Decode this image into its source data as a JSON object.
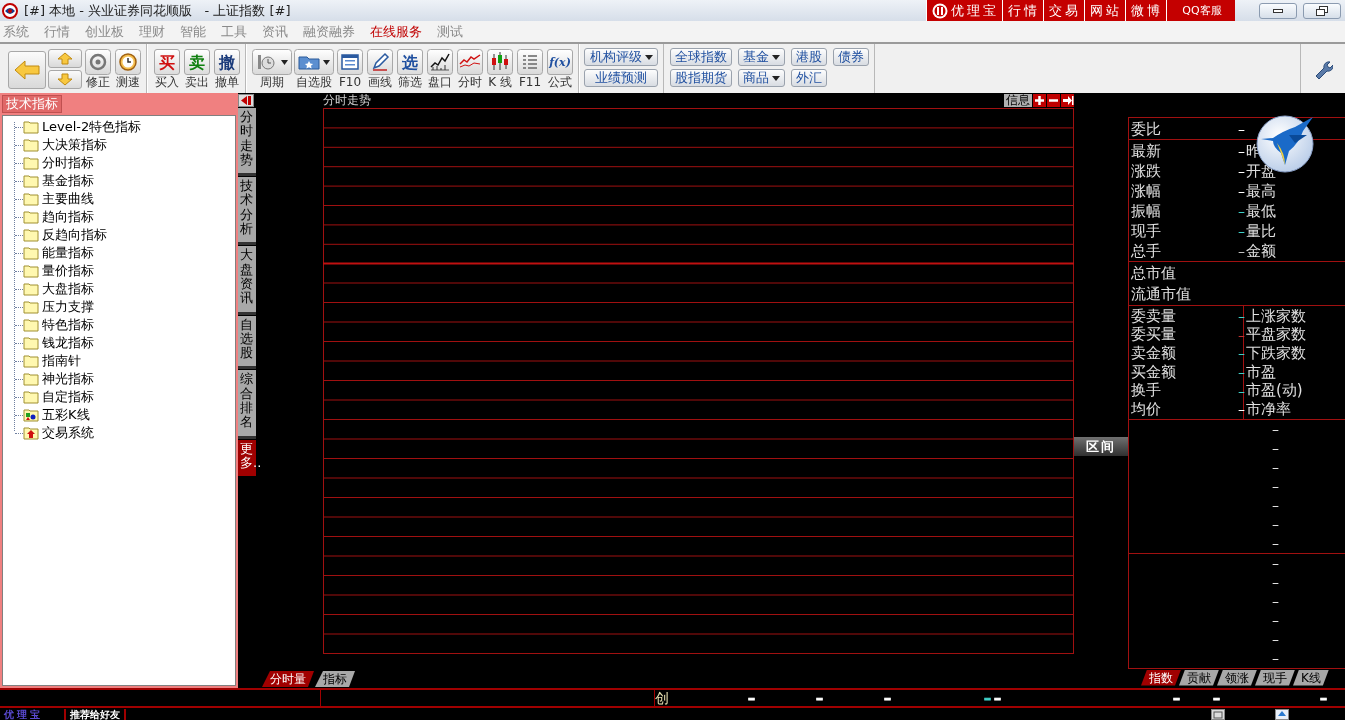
{
  "window": {
    "title": "[#] 本地 - 兴业证券同花顺版   - 上证指数 [#]"
  },
  "top_links": [
    {
      "label": "优理宝",
      "kind": "brand"
    },
    {
      "label": "行情",
      "kind": "plain"
    },
    {
      "label": "交易",
      "kind": "plain"
    },
    {
      "label": "网站",
      "kind": "plain"
    },
    {
      "label": "微博",
      "kind": "plain"
    },
    {
      "label": "QQ客服",
      "kind": "wide"
    }
  ],
  "menu": [
    {
      "label": "系统",
      "selected": false
    },
    {
      "label": "行情",
      "selected": false
    },
    {
      "label": "创业板",
      "selected": false
    },
    {
      "label": "理财",
      "selected": false
    },
    {
      "label": "智能",
      "selected": false
    },
    {
      "label": "工具",
      "selected": false
    },
    {
      "label": "资讯",
      "selected": false
    },
    {
      "label": "融资融券",
      "selected": false
    },
    {
      "label": "在线服务",
      "selected": true
    },
    {
      "label": "测试",
      "selected": false
    }
  ],
  "toolbar": {
    "groups": [
      [
        {
          "kind": "back"
        },
        {
          "kind": "updown"
        },
        {
          "kind": "refresh",
          "label": "修正"
        },
        {
          "kind": "clock",
          "label": "测速"
        }
      ],
      [
        {
          "kind": "glyph",
          "glyph": "买",
          "color": "#d01010",
          "label": "买入"
        },
        {
          "kind": "glyph",
          "glyph": "卖",
          "color": "#108010",
          "label": "卖出"
        },
        {
          "kind": "glyph",
          "glyph": "撤",
          "color": "#1a3a7a",
          "label": "撤单"
        }
      ],
      [
        {
          "kind": "period",
          "label": "周期"
        },
        {
          "kind": "folder",
          "label": "自选股"
        },
        {
          "kind": "doc",
          "label": "F10"
        },
        {
          "kind": "pencil",
          "label": "画线"
        },
        {
          "kind": "glyph",
          "glyph": "选",
          "color": "#2050a0",
          "label": "筛选"
        },
        {
          "kind": "depth",
          "label": "盘口"
        },
        {
          "kind": "trend",
          "label": "分时"
        },
        {
          "kind": "candle",
          "label": "K 线"
        },
        {
          "kind": "list",
          "label": "F11"
        },
        {
          "kind": "glyph",
          "glyph": "f(x)",
          "color": "#2050a0",
          "label": "公式"
        }
      ]
    ],
    "rating_buttons": [
      {
        "label": "机构评级",
        "dropdown": true
      },
      {
        "label": "业绩预测",
        "dropdown": false
      }
    ],
    "market_buttons": [
      [
        {
          "label": "全球指数",
          "dropdown": false
        },
        {
          "label": "基金",
          "dropdown": true
        },
        {
          "label": "港股",
          "dropdown": false
        },
        {
          "label": "债券",
          "dropdown": false
        }
      ],
      [
        {
          "label": "股指期货",
          "dropdown": false
        },
        {
          "label": "商品",
          "dropdown": true
        },
        {
          "label": "外汇",
          "dropdown": false
        }
      ]
    ]
  },
  "indicator_panel": {
    "title": "技术指标",
    "items": [
      {
        "label": "Level-2特色指标",
        "kind": "folder"
      },
      {
        "label": "大决策指标",
        "kind": "folder"
      },
      {
        "label": "分时指标",
        "kind": "folder"
      },
      {
        "label": "基金指标",
        "kind": "folder"
      },
      {
        "label": "主要曲线",
        "kind": "folder"
      },
      {
        "label": "趋向指标",
        "kind": "folder"
      },
      {
        "label": "反趋向指标",
        "kind": "folder"
      },
      {
        "label": "能量指标",
        "kind": "folder"
      },
      {
        "label": "量价指标",
        "kind": "folder"
      },
      {
        "label": "大盘指标",
        "kind": "folder"
      },
      {
        "label": "压力支撑",
        "kind": "folder"
      },
      {
        "label": "特色指标",
        "kind": "folder"
      },
      {
        "label": "钱龙指标",
        "kind": "folder"
      },
      {
        "label": "指南针",
        "kind": "folder"
      },
      {
        "label": "神光指标",
        "kind": "folder"
      },
      {
        "label": "自定指标",
        "kind": "folder"
      },
      {
        "label": "五彩K线",
        "kind": "colors"
      },
      {
        "label": "交易系统",
        "kind": "arrow"
      }
    ]
  },
  "side_tabs": [
    {
      "label": "分时走势",
      "selected": false
    },
    {
      "label": "技术分析",
      "selected": false
    },
    {
      "label": "大盘资讯",
      "selected": false
    },
    {
      "label": "自选股",
      "selected": false
    },
    {
      "label": "综合排名",
      "selected": false
    },
    {
      "label": "更多..",
      "selected": true
    }
  ],
  "chart": {
    "title": "分时走势",
    "info_button": "信息",
    "range_button": "区间",
    "tabs": [
      {
        "label": "分时量",
        "selected": true
      },
      {
        "label": "指标",
        "selected": false
      }
    ]
  },
  "quote": {
    "sections": [
      {
        "kind": "pair",
        "rows": [
          {
            "label": "委比",
            "value": "–",
            "color": "#ffffff"
          }
        ]
      },
      {
        "kind": "pair",
        "rows": [
          {
            "label": "最新",
            "value": "–",
            "color": "#ffffff",
            "label2": "昨"
          },
          {
            "label": "涨跌",
            "value": "–",
            "color": "#ffffff",
            "label2": "开盘"
          },
          {
            "label": "涨幅",
            "value": "–",
            "color": "#ffffff",
            "label2": "最高"
          },
          {
            "label": "振幅",
            "value": "–",
            "color": "#40d0c8",
            "label2": "最低"
          },
          {
            "label": "现手",
            "value": "–",
            "color": "#40d0c8",
            "label2": "量比"
          },
          {
            "label": "总手",
            "value": "–",
            "color": "#c0c0c0",
            "label2": "金额"
          }
        ]
      },
      {
        "kind": "plain",
        "rows": [
          {
            "label": "总市值"
          },
          {
            "label": "流通市值"
          }
        ]
      },
      {
        "kind": "split",
        "rows": [
          {
            "label": "委卖量",
            "value": "–",
            "color": "#40d0c8",
            "label2": "上涨家数"
          },
          {
            "label": "委买量",
            "value": "–",
            "color": "#c03030",
            "label2": "平盘家数"
          },
          {
            "label": "卖金额",
            "value": "–",
            "color": "#40d0c8",
            "label2": "下跌家数"
          },
          {
            "label": "买金额",
            "value": "–",
            "color": "#40d0c8",
            "label2": "市盈"
          },
          {
            "label": "换手",
            "value": "–",
            "color": "#40d0c8",
            "label2": "市盈(动)"
          },
          {
            "label": "均价",
            "value": "–",
            "color": "#ffffff",
            "label2": "市净率"
          }
        ]
      },
      {
        "kind": "dashes",
        "rows": [
          {
            "value": "–"
          },
          {
            "value": "–"
          },
          {
            "value": "–"
          },
          {
            "value": "–"
          },
          {
            "value": "–"
          },
          {
            "value": "–"
          },
          {
            "value": "–"
          }
        ]
      },
      {
        "kind": "dashes",
        "rows": [
          {
            "value": "–"
          },
          {
            "value": "–"
          },
          {
            "value": "–"
          },
          {
            "value": "–"
          },
          {
            "value": "–"
          },
          {
            "value": "–"
          }
        ]
      }
    ],
    "tabs": [
      {
        "label": "指数",
        "selected": true
      },
      {
        "label": "贡献",
        "selected": false
      },
      {
        "label": "领涨",
        "selected": false
      },
      {
        "label": "现手",
        "selected": false
      },
      {
        "label": "K线",
        "selected": false
      }
    ]
  },
  "status_bar": {
    "label": "创",
    "values": [
      {
        "text": "–",
        "color": "#ffffff"
      },
      {
        "text": "–",
        "color": "#ffffff"
      },
      {
        "text": "–",
        "color": "#ffffff"
      },
      {
        "text": "–",
        "color": "#40d0c8"
      },
      {
        "text": "–",
        "color": "#ffffff"
      },
      {
        "text": "–",
        "color": "#ffffff"
      },
      {
        "text": "–",
        "color": "#ffffff"
      },
      {
        "text": "–",
        "color": "#ffffff"
      }
    ]
  },
  "footer": {
    "brand": "优理宝",
    "share_link": "推荐给好友"
  }
}
